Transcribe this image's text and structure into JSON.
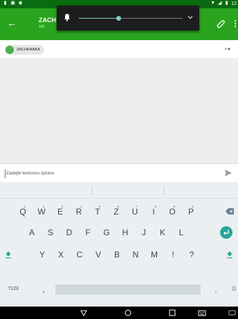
{
  "colors": {
    "appbar": "#2aa41e",
    "statusbar": "#0a6b10",
    "accent": "#80cbc4",
    "keyboard": "#eceff1",
    "enter": "#26a69a"
  },
  "statusbar": {
    "left_icons": [
      "notification-icon",
      "sim-icon",
      "app-icon"
    ],
    "right_icons": [
      "wifi-icon",
      "signal-icon",
      "battery-icon"
    ],
    "time": "12"
  },
  "appbar": {
    "title": "ZACH",
    "subtitle": "155",
    "back_icon": "back-arrow-icon",
    "attach_icon": "paperclip-icon",
    "menu_icon": "overflow-menu-icon"
  },
  "volume": {
    "level": 0.38,
    "icon": "bell-icon",
    "expand_icon": "chevron-down-icon"
  },
  "recipient": {
    "chip_label": "ZACHRANKA",
    "add_icon": "add-person-icon"
  },
  "compose": {
    "placeholder": "Zadejte textovou zprávu",
    "send_icon": "send-icon"
  },
  "keyboard": {
    "row1": [
      {
        "label": "Q",
        "hint": "1"
      },
      {
        "label": "W",
        "hint": "2"
      },
      {
        "label": "E",
        "hint": "3"
      },
      {
        "label": "R",
        "hint": "4"
      },
      {
        "label": "T",
        "hint": "5"
      },
      {
        "label": "Z",
        "hint": "6"
      },
      {
        "label": "U",
        "hint": "7"
      },
      {
        "label": "I",
        "hint": "8"
      },
      {
        "label": "O",
        "hint": "9"
      },
      {
        "label": "P",
        "hint": "0"
      }
    ],
    "row2": [
      "A",
      "S",
      "D",
      "F",
      "G",
      "H",
      "J",
      "K",
      "L"
    ],
    "row3": [
      "Y",
      "X",
      "C",
      "V",
      "B",
      "N",
      "M",
      "!",
      "?"
    ],
    "symbols_label": "?123",
    "comma": ",",
    "period": "."
  },
  "navbar": {
    "icons": [
      "back-nav-icon",
      "home-icon",
      "recents-icon",
      "keyboard-switch-icon"
    ]
  }
}
